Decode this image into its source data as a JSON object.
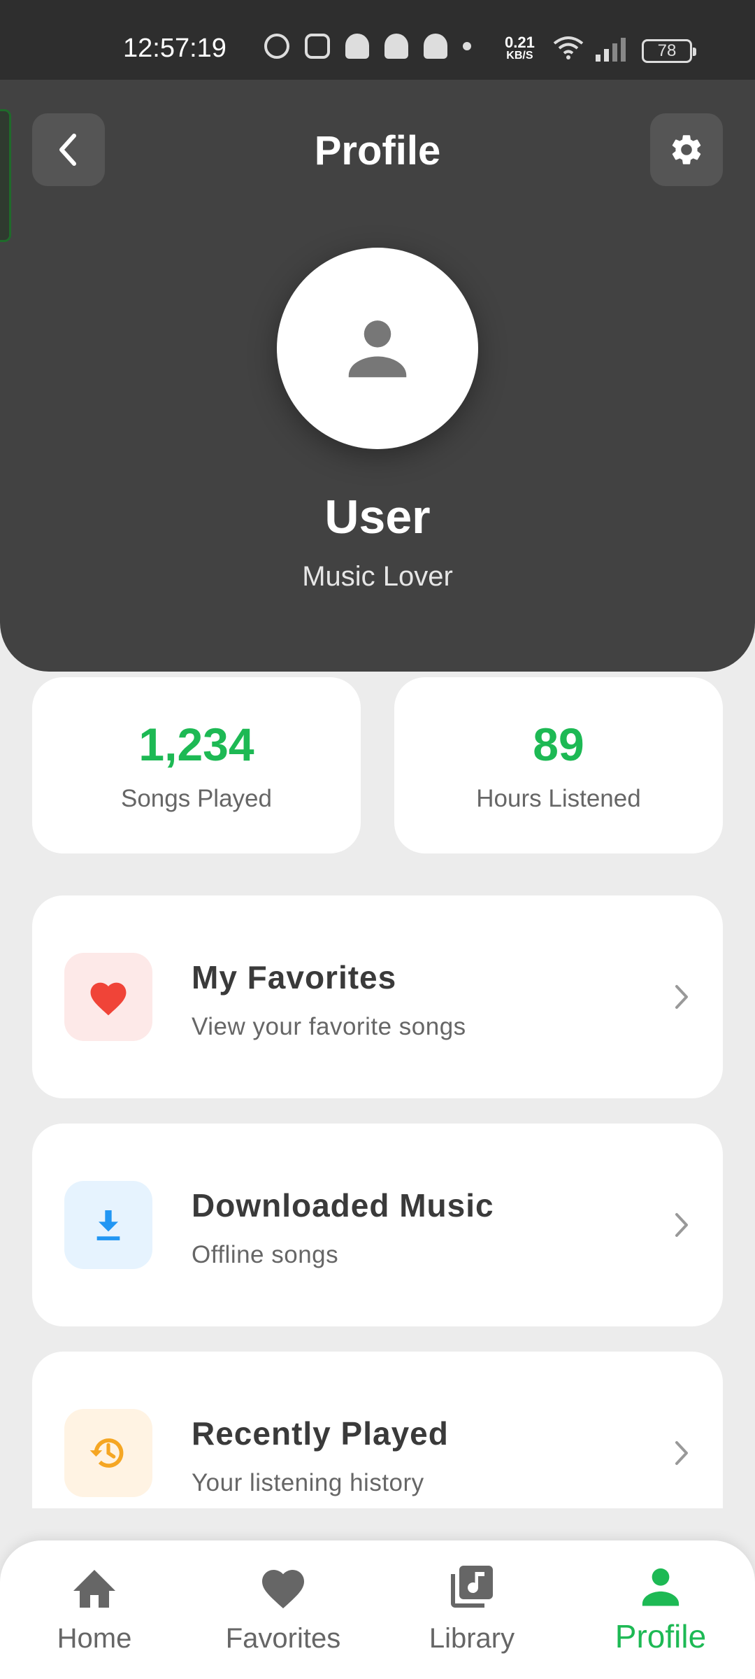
{
  "status_bar": {
    "time": "12:57:19",
    "net_speed_value": "0.21",
    "net_speed_unit": "KB/S",
    "battery": "78"
  },
  "header": {
    "title": "Profile",
    "user_name": "User",
    "user_subtitle": "Music Lover"
  },
  "stats": [
    {
      "value": "1,234",
      "label": "Songs Played"
    },
    {
      "value": "89",
      "label": "Hours Listened"
    }
  ],
  "menu": [
    {
      "title": "My Favorites",
      "subtitle": "View your favorite songs",
      "icon": "heart-icon",
      "icon_color": "#f04438",
      "icon_bg": "#fde9e8"
    },
    {
      "title": "Downloaded Music",
      "subtitle": "Offline songs",
      "icon": "download-icon",
      "icon_color": "#2196f3",
      "icon_bg": "#e6f3fe"
    },
    {
      "title": "Recently Played",
      "subtitle": "Your listening history",
      "icon": "history-icon",
      "icon_color": "#f5a623",
      "icon_bg": "#fff3e3"
    }
  ],
  "bottom_nav": [
    {
      "label": "Home",
      "icon": "home-icon"
    },
    {
      "label": "Favorites",
      "icon": "heart-icon"
    },
    {
      "label": "Library",
      "icon": "library-music-icon"
    },
    {
      "label": "Profile",
      "icon": "person-icon",
      "active": true
    }
  ],
  "colors": {
    "accent": "#1db954",
    "header_bg": "#424242",
    "page_bg": "#ececec"
  }
}
